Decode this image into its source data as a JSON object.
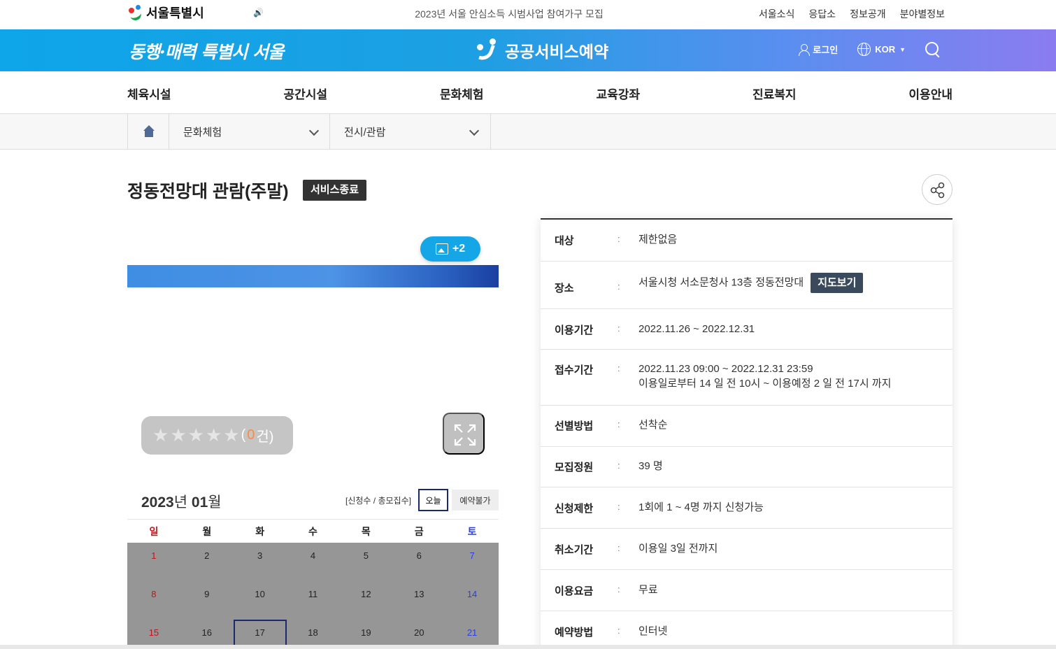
{
  "topbar": {
    "logo_text": "서울특별시",
    "notice": "2023년 서울 안심소득 시범사업 참여가구 모집",
    "links": [
      "서울소식",
      "응답소",
      "정보공개",
      "분야별정보"
    ]
  },
  "banner": {
    "slogan": "동행·매력 특별시 서울",
    "brand": "공공서비스예약",
    "login": "로그인",
    "language": "KOR"
  },
  "gnb": [
    "체육시설",
    "공간시설",
    "문화체험",
    "교육강좌",
    "진료복지",
    "이용안내"
  ],
  "breadcrumb": {
    "level1": "문화체험",
    "level2": "전시/관람"
  },
  "page": {
    "title": "정동전망대 관람(주말)",
    "status": "서비스종료"
  },
  "gallery": {
    "more_count": "+2"
  },
  "rating": {
    "stars": 0,
    "max_stars": 5,
    "count_open": "(",
    "count": "0",
    "count_close": " 건)"
  },
  "calendar": {
    "year": "2023",
    "year_suffix": "년",
    "month": "01",
    "month_suffix": "월",
    "legend": "[신청수 / 총모집수]",
    "today_label": "오늘",
    "unavailable_label": "예약불가",
    "weekdays": [
      "일",
      "월",
      "화",
      "수",
      "목",
      "금",
      "토"
    ],
    "days": [
      "1",
      "2",
      "3",
      "4",
      "5",
      "6",
      "7",
      "8",
      "9",
      "10",
      "11",
      "12",
      "13",
      "14",
      "15",
      "16",
      "17",
      "18",
      "19",
      "20",
      "21"
    ],
    "today": "17"
  },
  "info": {
    "rows": [
      {
        "label": "대상",
        "value": "제한없음"
      },
      {
        "label": "장소",
        "value": "서울시청 서소문청사 13층 정동전망대",
        "button": "지도보기"
      },
      {
        "label": "이용기간",
        "value": "2022.11.26 ~ 2022.12.31"
      },
      {
        "label": "접수기간",
        "value": "2022.11.23 09:00 ~ 2022.12.31 23:59",
        "value2": "이용일로부터 14 일 전 10시 ~ 이용예정 2 일 전 17시 까지"
      },
      {
        "label": "선별방법",
        "value": "선착순"
      },
      {
        "label": "모집정원",
        "value": "39 명"
      },
      {
        "label": "신청제한",
        "value": "1회에 1 ~ 4명 까지 신청가능"
      },
      {
        "label": "취소기간",
        "value": "이용일 3일 전까지"
      },
      {
        "label": "이용요금",
        "value": "무료"
      },
      {
        "label": "예약방법",
        "value": "인터넷"
      }
    ],
    "colon": ":"
  }
}
